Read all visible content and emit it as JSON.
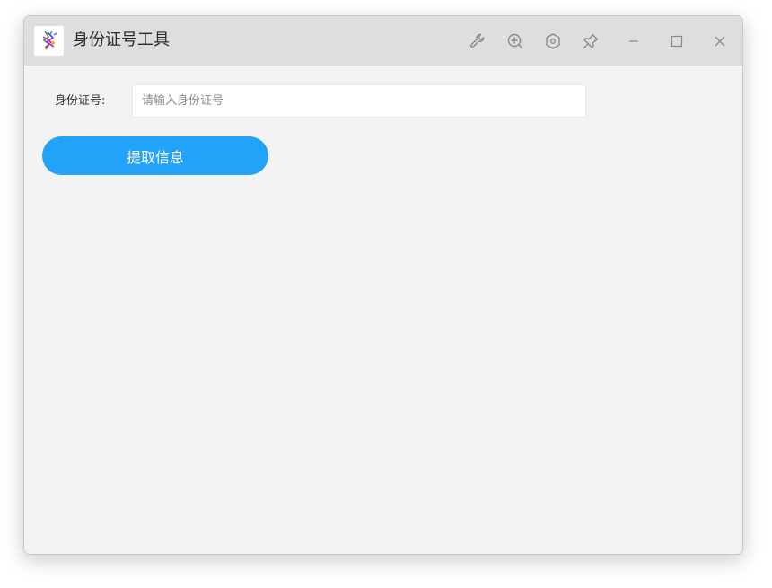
{
  "window": {
    "title": "身份证号工具"
  },
  "toolbar": {
    "icons": [
      "wrench-icon",
      "zoom-in-icon",
      "settings-icon",
      "pin-icon",
      "minimize-icon",
      "maximize-icon",
      "close-icon"
    ]
  },
  "form": {
    "id_label": "身份证号:",
    "id_placeholder": "请输入身份证号",
    "id_value": "",
    "extract_button_label": "提取信息"
  },
  "colors": {
    "accent": "#22a2f9",
    "titlebar": "#dedede",
    "body": "#f3f3f3",
    "icon": "#8a8a8a"
  }
}
